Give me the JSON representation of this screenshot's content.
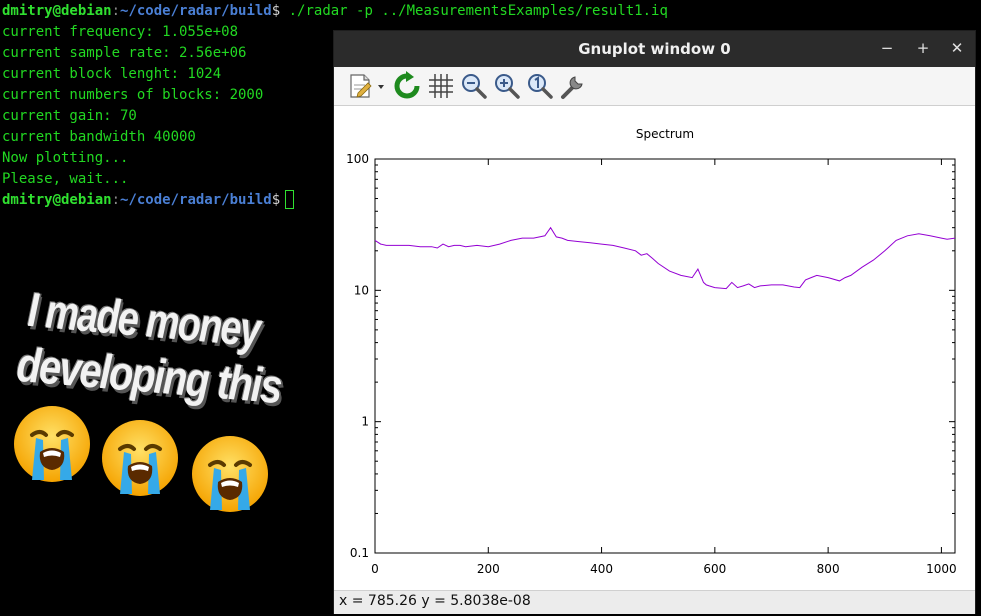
{
  "terminal": {
    "prompt_user": "dmitry@debian",
    "prompt_sep": ":",
    "prompt_path": "~/code/radar/build",
    "prompt_dollar": "$",
    "command": " ./radar -p ../MeasurementsExamples/result1.iq",
    "output": [
      "current frequency: 1.055e+08",
      "current sample rate: 2.56e+06",
      "current block lenght: 1024",
      "current numbers of blocks: 2000",
      "current gain: 70",
      "current bandwidth 40000",
      "Now plotting...",
      "Please, wait..."
    ]
  },
  "meme": {
    "line1": "I made money",
    "line2": "developing this",
    "emoji": [
      "loudly-crying-face",
      "loudly-crying-face",
      "loudly-crying-face"
    ]
  },
  "window": {
    "title": "Gnuplot window 0",
    "controls": [
      "−",
      "+",
      "✕"
    ],
    "toolbar": [
      "copy-to-clipboard-icon",
      "replot-icon",
      "grid-icon",
      "zoom-out-icon",
      "zoom-in-icon",
      "zoom-reset-icon",
      "settings-wrench-icon"
    ],
    "status": "x = 785.26 y = 5.8038e-08"
  },
  "colors": {
    "terminal_green": "#22d822",
    "path_blue": "#4a7fd4",
    "series_purple": "#9400d3"
  },
  "chart_data": {
    "type": "line",
    "title": "Spectrum",
    "xlim": [
      0,
      1024
    ],
    "ylim": [
      0.1,
      100
    ],
    "yscale": "log",
    "x_ticks": [
      0,
      200,
      400,
      600,
      800,
      1000
    ],
    "x_tick_labels": [
      "0",
      "200",
      "400",
      "600",
      "800",
      "1000"
    ],
    "y_ticks": [
      0.1,
      1,
      10,
      100
    ],
    "y_tick_labels": [
      "0.1",
      "1",
      "10",
      "100"
    ],
    "grid": false,
    "series": [
      {
        "color": "#9400d3",
        "x": [
          0,
          10,
          20,
          40,
          60,
          80,
          100,
          110,
          120,
          130,
          140,
          150,
          160,
          180,
          200,
          220,
          240,
          260,
          280,
          300,
          310,
          320,
          330,
          340,
          360,
          380,
          400,
          420,
          440,
          460,
          470,
          480,
          490,
          500,
          520,
          540,
          560,
          570,
          580,
          585,
          590,
          600,
          620,
          630,
          640,
          650,
          660,
          670,
          680,
          700,
          720,
          740,
          750,
          760,
          770,
          780,
          800,
          820,
          830,
          840,
          860,
          880,
          900,
          920,
          940,
          960,
          980,
          1000,
          1010,
          1024
        ],
        "y": [
          24,
          22.5,
          22,
          22,
          22,
          21.5,
          21.5,
          21,
          22.5,
          21.5,
          22,
          22,
          21.5,
          22,
          21.5,
          22.5,
          24,
          25,
          25,
          26,
          30,
          25.5,
          25,
          24,
          23.5,
          23,
          22.5,
          22,
          21,
          20,
          18.5,
          19,
          17.5,
          16,
          14,
          13,
          12.5,
          14.5,
          11.5,
          11,
          10.8,
          10.5,
          10.3,
          11.5,
          10.5,
          10.8,
          11.2,
          10.5,
          10.8,
          11,
          11,
          10.6,
          10.5,
          12,
          12.5,
          13,
          12.5,
          11.8,
          12.5,
          13,
          15,
          17,
          20,
          24,
          26,
          27,
          26,
          25,
          24.5,
          25
        ]
      }
    ]
  }
}
